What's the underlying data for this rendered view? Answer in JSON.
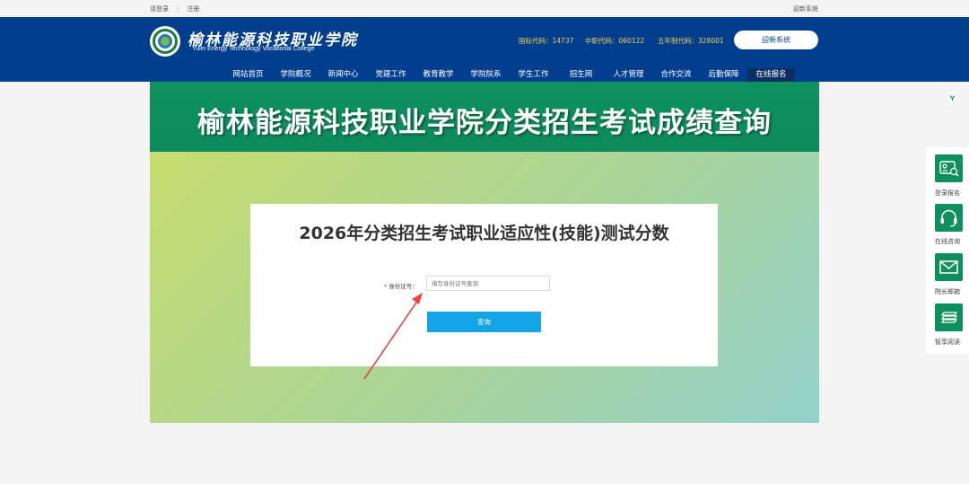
{
  "topbar": {
    "login": "请登录",
    "register": "注册",
    "welcome": "迎新系统"
  },
  "header": {
    "brand_cn": "榆林能源科技职业学院",
    "brand_en": "Yulin Energy Technology Vocational College",
    "code_national": "国标代码：14737",
    "code_secondary": "中职代码：060122",
    "code_five_year": "五年制代码：328001",
    "welcome_button": "迎新系统"
  },
  "nav": {
    "items": [
      "网站首页",
      "学院概况",
      "新闻中心",
      "党建工作",
      "教育教学",
      "学院院系",
      "学生工作",
      "招生网",
      "人才管理",
      "合作交流",
      "后勤保障",
      "在线报名"
    ],
    "active_index": 11
  },
  "banner": {
    "title": "榆林能源科技职业学院分类招生考试成绩查询"
  },
  "form": {
    "title": "2026年分类招生考试职业适应性(技能)测试分数",
    "required_mark": "*",
    "id_label": "身份证号：",
    "id_placeholder": "填写身份证号查询",
    "id_value": "",
    "query_button": "查询"
  },
  "side": {
    "items": [
      {
        "label": "登录报名",
        "icon": "id-card-icon"
      },
      {
        "label": "在线咨询",
        "icon": "headset-icon"
      },
      {
        "label": "院长邮箱",
        "icon": "mail-icon"
      },
      {
        "label": "智享阅读",
        "icon": "book-stack-icon"
      }
    ]
  },
  "colors": {
    "header_blue": "#013f8e",
    "banner_green": "#0f9160",
    "code_yellow": "#f6d24a",
    "query_blue": "#14a5e6",
    "arrow_red": "#e8453c"
  }
}
